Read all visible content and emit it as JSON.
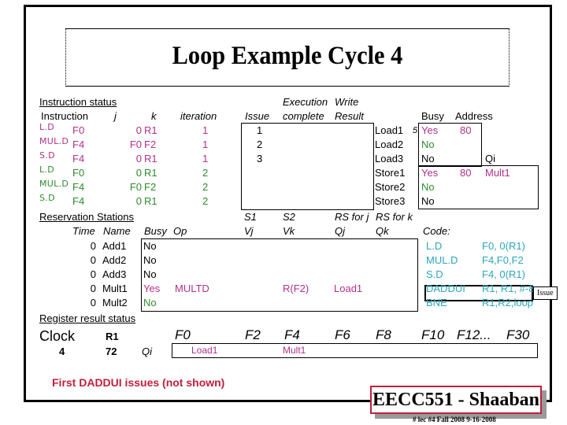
{
  "slide": {
    "title": "Loop Example Cycle 4",
    "note": "First  DADDUI  issues  (not shown)",
    "badge": "EECC551 - Shaaban",
    "footer": "#  lec #4  Fall 2008     9-16-2008",
    "tooltip": "Issue"
  },
  "colors": {
    "iteration1": "#b0308a",
    "iteration2": "#2e8b2e",
    "code": "#2aa6b8",
    "note": "#c0203c"
  },
  "instruction_status": {
    "heading": "Instruction status",
    "headers": {
      "instruction": "Instruction",
      "j": "j",
      "k": "k",
      "iteration": "iteration",
      "issue": "Issue",
      "exec_top": "Execution",
      "exec_bottom": "complete",
      "write_top": "Write",
      "write_bottom": "Result"
    },
    "rows": [
      {
        "op": "L.D",
        "dest": "F0",
        "j": "0",
        "k": "R1",
        "iteration": "1",
        "issue": "1",
        "exec": "",
        "write": ""
      },
      {
        "op": "MUL.D",
        "dest": "F4",
        "j": "F0",
        "k": "F2",
        "iteration": "1",
        "issue": "2",
        "exec": "",
        "write": ""
      },
      {
        "op": "S.D",
        "dest": "F4",
        "j": "0",
        "k": "R1",
        "iteration": "1",
        "issue": "3",
        "exec": "",
        "write": ""
      },
      {
        "op": "L.D",
        "dest": "F0",
        "j": "0",
        "k": "R1",
        "iteration": "2",
        "issue": "",
        "exec": "",
        "write": ""
      },
      {
        "op": "MUL.D",
        "dest": "F4",
        "j": "F0",
        "k": "F2",
        "iteration": "2",
        "issue": "",
        "exec": "",
        "write": ""
      },
      {
        "op": "S.D",
        "dest": "F4",
        "j": "0",
        "k": "R1",
        "iteration": "2",
        "issue": "",
        "exec": "",
        "write": ""
      }
    ]
  },
  "load_store_buffers": {
    "headers": {
      "busy": "Busy",
      "address": "Address",
      "qi": "Qi"
    },
    "rows": [
      {
        "name": "Load1",
        "marker": "5",
        "busy": "Yes",
        "address": "80",
        "qi": ""
      },
      {
        "name": "Load2",
        "marker": "",
        "busy": "No",
        "address": "",
        "qi": ""
      },
      {
        "name": "Load3",
        "marker": "",
        "busy": "No",
        "address": "",
        "qi": ""
      },
      {
        "name": "Store1",
        "marker": "",
        "busy": "Yes",
        "address": "80",
        "qi": "Mult1"
      },
      {
        "name": "Store2",
        "marker": "",
        "busy": "No",
        "address": "",
        "qi": ""
      },
      {
        "name": "Store3",
        "marker": "",
        "busy": "No",
        "address": "",
        "qi": ""
      }
    ]
  },
  "reservation_stations": {
    "heading": "Reservation Stations",
    "headers": {
      "time": "Time",
      "name": "Name",
      "busy": "Busy",
      "op": "Op",
      "s1": "S1",
      "vj": "Vj",
      "s2": "S2",
      "vk": "Vk",
      "rsj": "RS for j",
      "qj": "Qj",
      "rsk": "RS for k",
      "qk": "Qk"
    },
    "rows": [
      {
        "time": "0",
        "name": "Add1",
        "busy": "No",
        "op": "",
        "vj": "",
        "vk": "",
        "qj": "",
        "qk": ""
      },
      {
        "time": "0",
        "name": "Add2",
        "busy": "No",
        "op": "",
        "vj": "",
        "vk": "",
        "qj": "",
        "qk": ""
      },
      {
        "time": "0",
        "name": "Add3",
        "busy": "No",
        "op": "",
        "vj": "",
        "vk": "",
        "qj": "",
        "qk": ""
      },
      {
        "time": "0",
        "name": "Mult1",
        "busy": "Yes",
        "op": "MULTD",
        "vj": "",
        "vk": "R(F2)",
        "qj": "Load1",
        "qk": ""
      },
      {
        "time": "0",
        "name": "Mult2",
        "busy": "No",
        "op": "",
        "vj": "",
        "vk": "",
        "qj": "",
        "qk": ""
      }
    ]
  },
  "code": {
    "label": "Code:",
    "lines": [
      {
        "op": "L.D",
        "args": "F0, 0(R1)"
      },
      {
        "op": "MUL.D",
        "args": "F4,F0,F2"
      },
      {
        "op": "S.D",
        "args": "F4, 0(R1)"
      },
      {
        "op": "DADDUI",
        "args": "R1, R1, #-8"
      },
      {
        "op": "BNE",
        "args": "R1,R2,loop"
      }
    ],
    "highlighted_index": 3
  },
  "register_result_status": {
    "heading": "Register result status",
    "clock_label": "Clock",
    "clock_value": "4",
    "r1_label": "R1",
    "r1_value": "72",
    "qi_label": "Qi",
    "registers": [
      {
        "name": "F0",
        "qi": "Load1"
      },
      {
        "name": "F2",
        "qi": ""
      },
      {
        "name": "F4",
        "qi": "Mult1"
      },
      {
        "name": "F6",
        "qi": ""
      },
      {
        "name": "F8",
        "qi": ""
      },
      {
        "name": "F10",
        "qi": ""
      },
      {
        "name": "F12...",
        "qi": ""
      },
      {
        "name": "F30",
        "qi": ""
      }
    ]
  }
}
